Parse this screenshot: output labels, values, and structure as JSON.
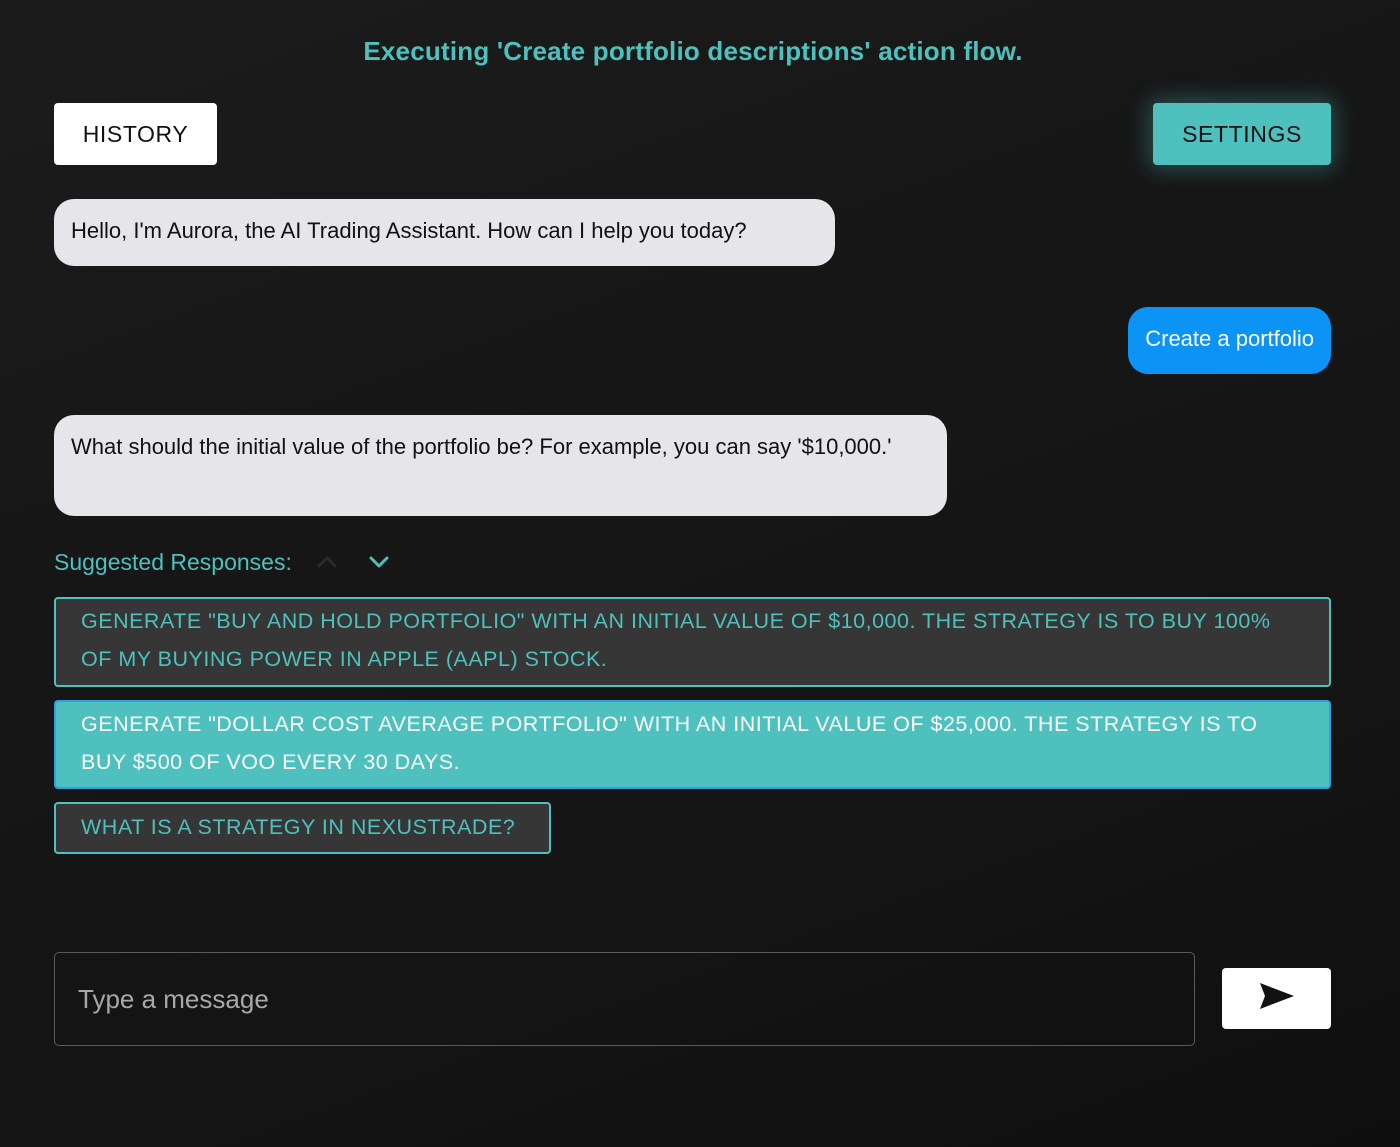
{
  "header": {
    "flow_title": "Executing 'Create portfolio descriptions' action flow."
  },
  "toolbar": {
    "history_label": "HISTORY",
    "settings_label": "SETTINGS"
  },
  "messages": [
    {
      "sender": "assistant",
      "text": "Hello, I'm Aurora, the AI Trading Assistant. How can I help you today?"
    },
    {
      "sender": "user",
      "text": "Create a portfolio"
    },
    {
      "sender": "assistant",
      "text": "What should the initial value of the portfolio be? For example, you can say '$10,000.'"
    }
  ],
  "suggested": {
    "label": "Suggested Responses:",
    "items": [
      {
        "text": "Generate \"Buy and Hold Portfolio\" with an initial value of $10,000. The strategy is to buy 100% of my buying power in Apple (AAPL) stock.",
        "selected": false
      },
      {
        "text": "Generate \"Dollar Cost Average Portfolio\" with an initial value of $25,000. The strategy is to buy $500 of VOO every 30 days.",
        "selected": true
      },
      {
        "text": "What is a strategy in NexusTrade?",
        "selected": false
      }
    ]
  },
  "composer": {
    "placeholder": "Type a message",
    "value": ""
  },
  "icons": {
    "collapse": "chevron-up-icon",
    "expand": "chevron-down-icon",
    "send": "send-icon"
  },
  "colors": {
    "accent": "#4ec0be",
    "user_bubble": "#0b93f6",
    "assistant_bubble": "#e5e5ea",
    "background": "#161616"
  }
}
